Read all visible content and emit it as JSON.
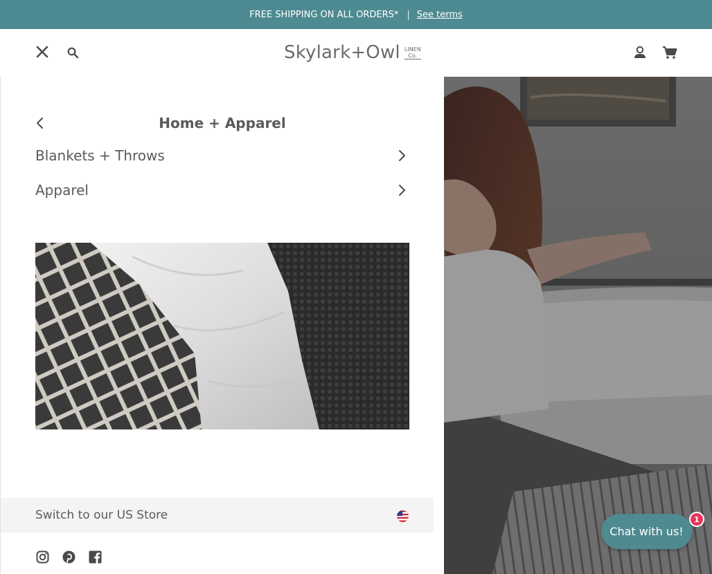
{
  "announcement": {
    "text": "FREE SHIPPING ON ALL ORDERS*",
    "separator": "|",
    "link_label": "See terms"
  },
  "header": {
    "logo": {
      "main": "Skylark+Owl",
      "sub_line1": "LINEN",
      "sub_line2": "Co."
    },
    "icons": [
      "close-icon",
      "search-icon",
      "account-icon",
      "cart-icon"
    ]
  },
  "drawer": {
    "title": "Home + Apparel",
    "items": [
      {
        "label": "Blankets + Throws"
      },
      {
        "label": "Apparel"
      }
    ],
    "switch_store_label": "Switch to our US Store",
    "social": [
      "instagram-icon",
      "pinterest-icon",
      "facebook-icon"
    ]
  },
  "chat": {
    "label": "Chat with us!",
    "badge": "1"
  },
  "colors": {
    "brand_teal": "#4e8a91",
    "badge_red": "#e5365d",
    "text_gray": "#5a5a5a"
  }
}
